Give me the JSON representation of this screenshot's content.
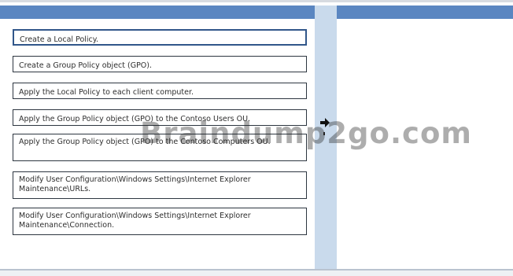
{
  "answer_area": {
    "items": [
      {
        "label": "Create a Local Policy."
      },
      {
        "label": "Create a Group Policy object (GPO)."
      },
      {
        "label": "Apply the Local Policy to each client computer."
      },
      {
        "label": "Apply the Group Policy object (GPO) to the Contoso Users OU."
      },
      {
        "label": "Apply the Group Policy object (GPO) to the Contoso Computers OU."
      },
      {
        "label": "Modify User Configuration\\Windows Settings\\Internet Explorer Maintenance\\URLs."
      },
      {
        "label": "Modify User Configuration\\Windows Settings\\Internet Explorer Maintenance\\Connection."
      }
    ],
    "move_arrow": {
      "icon": "right-arrow-icon"
    },
    "watermark": "Braindump2go.com",
    "colors": {
      "header": "#5a86c1",
      "middle_column": "#c9daec",
      "item_border": "#2d3640",
      "selected_border": "#31568a"
    }
  }
}
